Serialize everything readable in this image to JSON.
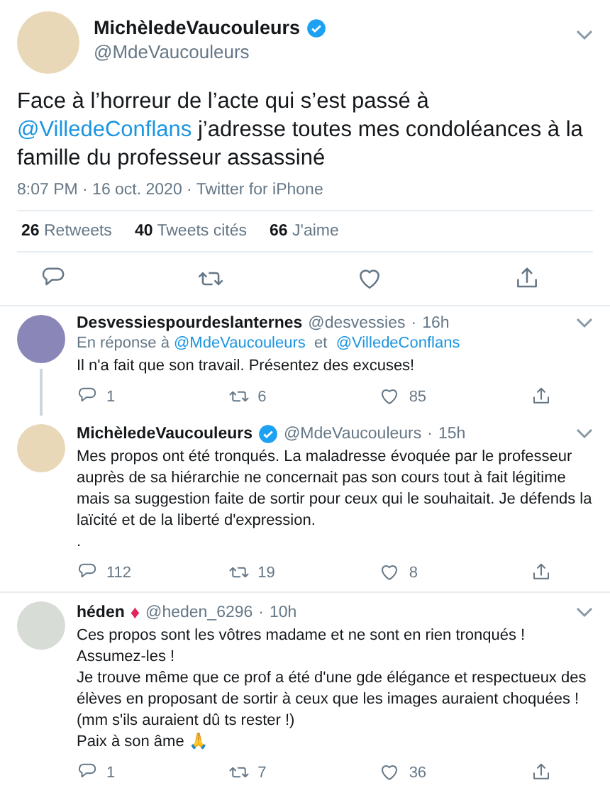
{
  "tweet": {
    "name": "MichèledeVaucouleurs",
    "verified": true,
    "handle": "@MdeVaucouleurs",
    "body": [
      {
        "kind": "text",
        "text": "Face à l’horreur de l’acte qui s’est passé à "
      },
      {
        "kind": "mention",
        "text": "@VilledeConflans"
      },
      {
        "kind": "text",
        "text": " j’adresse toutes mes condoléances à la famille du professeur assassiné"
      }
    ],
    "meta": "8:07 PM · 16 oct. 2020 · Twitter for iPhone",
    "stats": [
      {
        "count": "26",
        "label": "Retweets"
      },
      {
        "count": "40",
        "label": "Tweets cités"
      },
      {
        "count": "66",
        "label": "J'aime"
      }
    ]
  },
  "replies": [
    {
      "name": "Desvessiespourdeslanternes",
      "verified": false,
      "handle": "@desvessies",
      "dot": "·",
      "time": "16h",
      "thread_below": true,
      "reply_to": [
        {
          "kind": "text",
          "text": "En réponse à "
        },
        {
          "kind": "mention",
          "text": "@MdeVaucouleurs"
        },
        {
          "kind": "text",
          "text": "  et  "
        },
        {
          "kind": "mention",
          "text": "@VilledeConflans"
        }
      ],
      "lines": [
        "Il n'a fait que son travail. Présentez des excuses!"
      ],
      "replies": "1",
      "retweets": "6",
      "likes": "85"
    },
    {
      "name": "MichèledeVaucouleurs",
      "verified": true,
      "handle": "@MdeVaucouleurs",
      "dot": "·",
      "time": "15h",
      "thread_below": false,
      "lines": [
        "Mes propos ont été tronqués. La maladresse évoquée par le professeur auprès de sa hiérarchie ne concernait pas son cours tout à fait légitime mais sa suggestion faite de sortir pour ceux qui le souhaitait. Je défends la laïcité et de la liberté d'expression.",
        "."
      ],
      "replies": "112",
      "retweets": "19",
      "likes": "8"
    },
    {
      "name": "héden",
      "badge": "♦",
      "verified": false,
      "handle": "@heden_6296",
      "dot": "·",
      "time": "10h",
      "thread_below": false,
      "lines": [
        "Ces propos sont les vôtres madame et ne sont en rien tronqués !",
        "Assumez-les !",
        "Je trouve même que ce prof a été d'une gde élégance et respectueux des élèves en proposant de sortir à ceux que les images auraient choquées !",
        "(mm s'ils auraient dû ts rester !)",
        "Paix à son âme 🙏"
      ],
      "replies": "1",
      "retweets": "7",
      "likes": "36"
    }
  ]
}
